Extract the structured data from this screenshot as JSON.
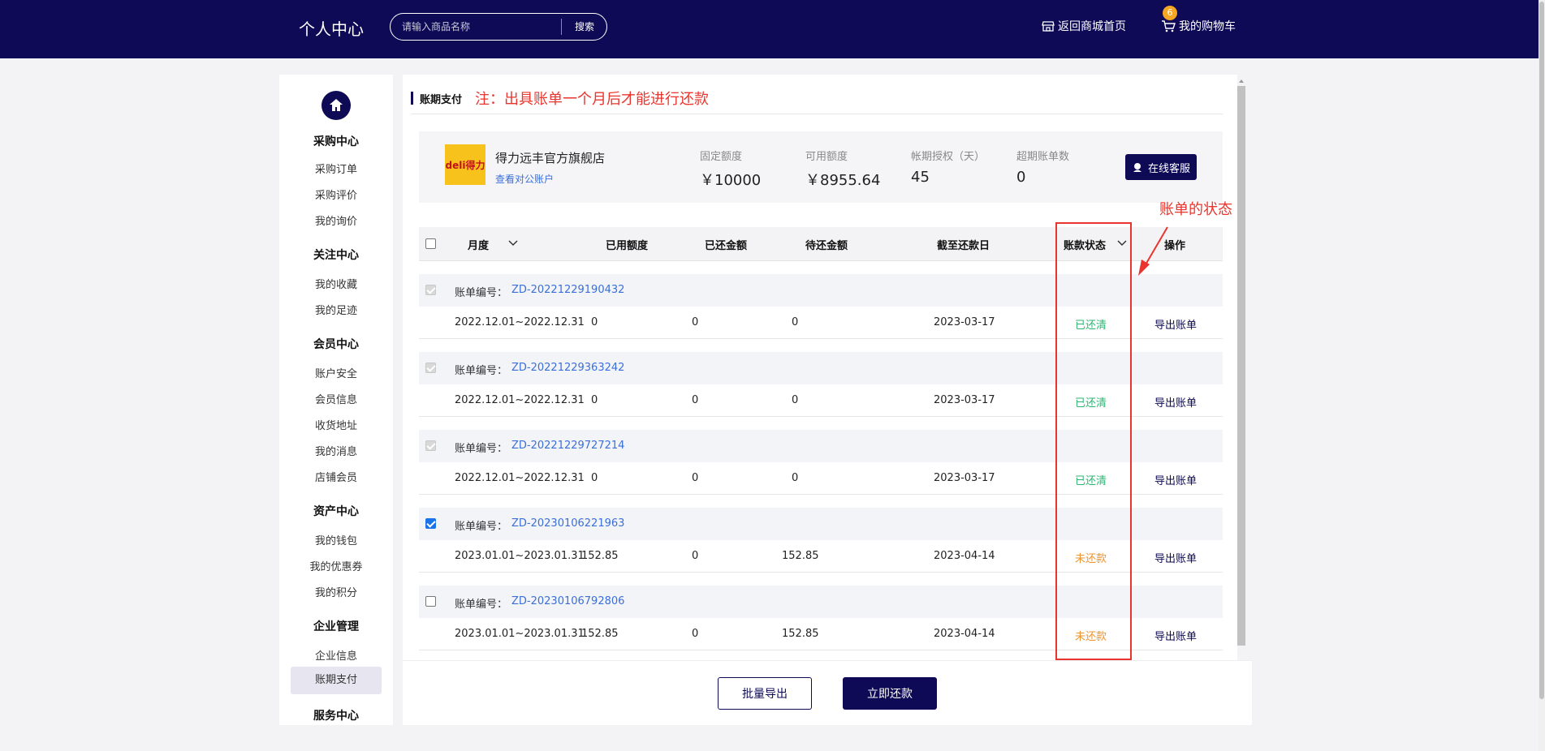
{
  "header": {
    "title": "个人中心",
    "search_placeholder": "请输入商品名称",
    "search_button": "搜索",
    "home_link": "返回商城首页",
    "cart_link": "我的购物车",
    "cart_count": "6"
  },
  "sidebar": {
    "groups": [
      {
        "title": "采购中心",
        "items": [
          "采购订单",
          "采购评价",
          "我的询价"
        ]
      },
      {
        "title": "关注中心",
        "items": [
          "我的收藏",
          "我的足迹"
        ]
      },
      {
        "title": "会员中心",
        "items": [
          "账户安全",
          "会员信息",
          "收货地址",
          "我的消息",
          "店铺会员"
        ]
      },
      {
        "title": "资产中心",
        "items": [
          "我的钱包",
          "我的优惠券",
          "我的积分"
        ]
      },
      {
        "title": "企业管理",
        "items": [
          "企业信息",
          "账期支付"
        ]
      },
      {
        "title": "服务中心",
        "items": []
      }
    ],
    "active_item": "账期支付"
  },
  "section": {
    "title": "账期支付",
    "note": "注：出具账单一个月后才能进行还款"
  },
  "store": {
    "logo_text": "deli得力",
    "name": "得力远丰官方旗舰店",
    "account_link": "查看对公账户",
    "stats": [
      {
        "label": "固定额度",
        "value": "￥10000"
      },
      {
        "label": "可用额度",
        "value": "￥8955.64"
      },
      {
        "label": "帐期授权（天）",
        "value": "45"
      },
      {
        "label": "超期账单数",
        "value": "0"
      }
    ],
    "service_button": "在线客服"
  },
  "table": {
    "headers": {
      "month": "月度",
      "used": "已用额度",
      "repaid": "已还金额",
      "pending": "待还金额",
      "due": "截至还款日",
      "status": "账款状态",
      "action": "操作"
    },
    "bill_label": "账单编号：",
    "rows": [
      {
        "bill_no": "ZD-20221229190432",
        "checkbox": "disabled",
        "period": "2022.12.01~2022.12.31",
        "used": "0",
        "repaid": "0",
        "pending": "0",
        "due": "2023-03-17",
        "status": "已还清",
        "status_type": "paid",
        "action": "导出账单"
      },
      {
        "bill_no": "ZD-20221229363242",
        "checkbox": "disabled",
        "period": "2022.12.01~2022.12.31",
        "used": "0",
        "repaid": "0",
        "pending": "0",
        "due": "2023-03-17",
        "status": "已还清",
        "status_type": "paid",
        "action": "导出账单"
      },
      {
        "bill_no": "ZD-20221229727214",
        "checkbox": "disabled",
        "period": "2022.12.01~2022.12.31",
        "used": "0",
        "repaid": "0",
        "pending": "0",
        "due": "2023-03-17",
        "status": "已还清",
        "status_type": "paid",
        "action": "导出账单"
      },
      {
        "bill_no": "ZD-20230106221963",
        "checkbox": "checked",
        "period": "2023.01.01~2023.01.31",
        "used": "152.85",
        "repaid": "0",
        "pending": "152.85",
        "due": "2023-04-14",
        "status": "未还款",
        "status_type": "unpaid",
        "action": "导出账单"
      },
      {
        "bill_no": "ZD-20230106792806",
        "checkbox": "unchecked",
        "period": "2023.01.01~2023.01.31",
        "used": "152.85",
        "repaid": "0",
        "pending": "152.85",
        "due": "2023-04-14",
        "status": "未还款",
        "status_type": "unpaid",
        "action": "导出账单"
      }
    ]
  },
  "footer": {
    "batch_export": "批量导出",
    "pay_now": "立即还款"
  },
  "annotation": {
    "text": "账单的状态"
  },
  "colors": {
    "brand": "#0e0a56",
    "paid": "#2bb673",
    "unpaid": "#f0932b",
    "annotation": "#e9352d",
    "link": "#3a6fd8"
  }
}
